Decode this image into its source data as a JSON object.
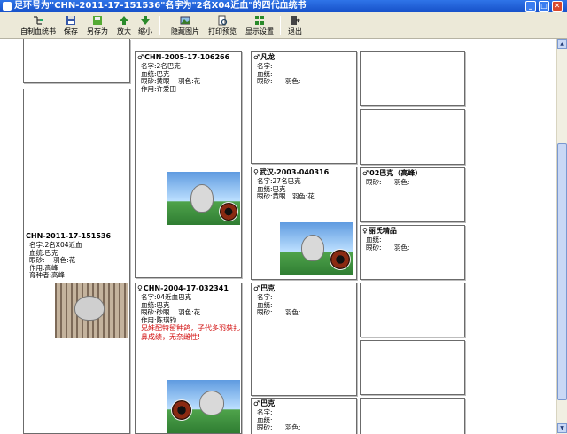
{
  "window": {
    "title": "足环号为\"CHN-2011-17-151536\"名字为\"2名X04近血\"的四代血统书",
    "min": "_",
    "max": "□",
    "close": "✕"
  },
  "toolbar": {
    "buttons": [
      {
        "id": "custom",
        "label": "自制血统书"
      },
      {
        "id": "save",
        "label": "保存"
      },
      {
        "id": "saveas",
        "label": "另存为"
      },
      {
        "id": "zoomin",
        "label": "放大"
      },
      {
        "id": "zoomout",
        "label": "缩小"
      },
      {
        "id": "hidephoto",
        "label": "隐藏图片"
      },
      {
        "id": "preview",
        "label": "打印预览"
      },
      {
        "id": "display",
        "label": "显示设置"
      },
      {
        "id": "exit",
        "label": "退出"
      }
    ]
  },
  "field_labels": {
    "name": "名字:",
    "blood": "血统:",
    "eye_color": "眼砂:",
    "feather": "羽色:",
    "achievement": "作用:",
    "breeder": "育种者:"
  },
  "symbols": {
    "male": "♂",
    "female": "♀"
  },
  "gen1": {
    "ring": "CHN-2011-17-151536",
    "name": "2名X04近血",
    "blood": "巴克",
    "eye": "",
    "feather": "花",
    "achievement": "高峰",
    "breeder": "高峰"
  },
  "gen2": {
    "sire": {
      "ring": "CHN-2005-17-106266",
      "name": "2名巴克",
      "blood": "巴克",
      "eye": "黄眼",
      "feather": "花",
      "achievement": "许爱田"
    },
    "dam": {
      "ring": "CHN-2004-17-032341",
      "name": "04近血巴克",
      "blood": "巴克",
      "eye": "砂眼",
      "feather": "花",
      "achievement": "陈琪钧",
      "note": "兄妹配特留种鸽，子代多羽获扎鼻成绩，无奈雌性!"
    }
  },
  "gen3": [
    {
      "ring": "凡龙",
      "name": "",
      "blood": "",
      "eye": "",
      "feather": ""
    },
    {
      "ring": "武汉-2003-040316",
      "name": "27名巴克",
      "blood": "巴克",
      "eye": "黄眼",
      "feather": "花"
    },
    {
      "ring": "巴克",
      "name": "",
      "blood": "",
      "eye": "",
      "feather": ""
    },
    {
      "ring": "巴克",
      "name": "",
      "blood": "",
      "eye": "",
      "feather": ""
    }
  ],
  "gen4": [
    {
      "ring": "02巴克（高峰）",
      "eye": "",
      "feather": ""
    },
    {
      "ring": "丽氏精品",
      "blood": "",
      "feather": ""
    }
  ]
}
